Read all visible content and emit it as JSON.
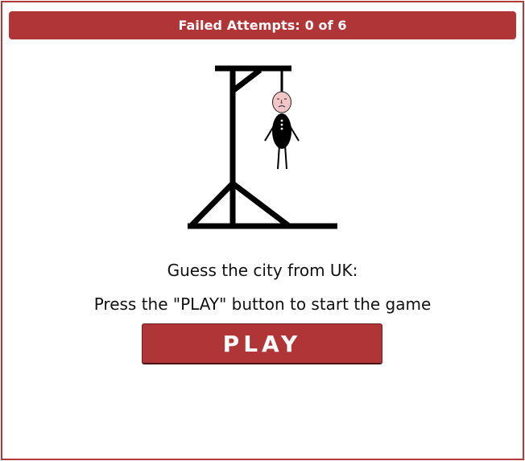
{
  "status": {
    "label": "Failed Attempts:",
    "failed": "0",
    "separator": "of",
    "max": "6"
  },
  "game": {
    "prompt": "Guess the city from UK:",
    "instruction": "Press the \"PLAY\" button to start the game",
    "play_label": "PLAY"
  },
  "colors": {
    "accent": "#b03537",
    "border": "#b03a3c",
    "face": "#f2c6c6",
    "ink": "#000000"
  }
}
